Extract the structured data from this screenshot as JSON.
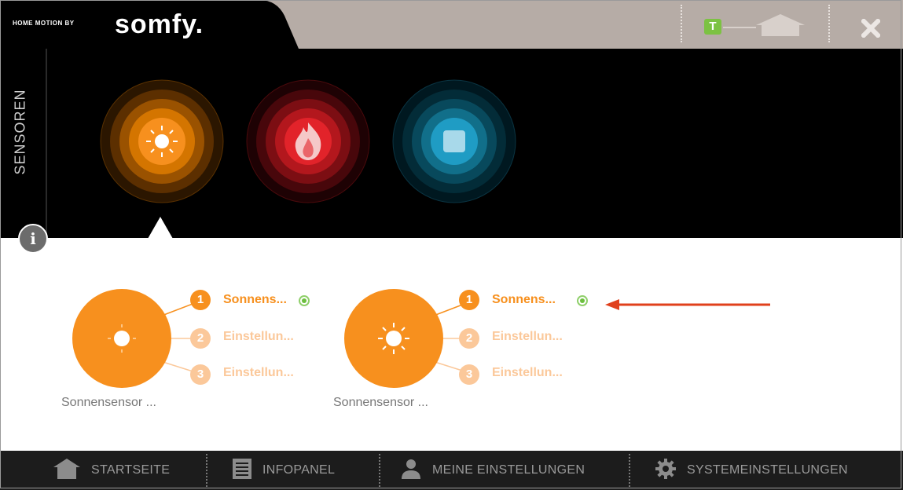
{
  "header": {
    "brand_small": "HOME MOTION BY",
    "brand_logo": "somfy.",
    "badge_letter": "T",
    "icons": [
      "t-badge-icon",
      "house-icon",
      "close-icon"
    ]
  },
  "sensors": {
    "title": "SENSOREN",
    "types": [
      {
        "name": "sun-sensor-icon",
        "color": "#f7901e",
        "selected": true
      },
      {
        "name": "fire-sensor-icon",
        "color": "#e2232a",
        "selected": false
      },
      {
        "name": "box-sensor-icon",
        "color": "#1f9cc4",
        "selected": false
      }
    ]
  },
  "cards": [
    {
      "name": "Sonnensensor ...",
      "items": [
        {
          "num": "1",
          "label": "Sonnens...",
          "active": true,
          "status": "online"
        },
        {
          "num": "2",
          "label": "Einstellun...",
          "active": false
        },
        {
          "num": "3",
          "label": "Einstellun...",
          "active": false
        }
      ]
    },
    {
      "name": "Sonnensensor ...",
      "items": [
        {
          "num": "1",
          "label": "Sonnens...",
          "active": true,
          "status": "online"
        },
        {
          "num": "2",
          "label": "Einstellun...",
          "active": false
        },
        {
          "num": "3",
          "label": "Einstellun...",
          "active": false
        }
      ]
    }
  ],
  "nav": {
    "startseite": "STARTSEITE",
    "infopanel": "INFOPANEL",
    "meine": "MEINE EINSTELLUNGEN",
    "system": "SYSTEMEINSTELLUNGEN"
  },
  "colors": {
    "accent": "#f7901e",
    "accent_dim": "#fbc89a",
    "header_bg": "#b6aca6",
    "status_green": "#6cbf3e",
    "annotation_arrow": "#e0401c"
  }
}
